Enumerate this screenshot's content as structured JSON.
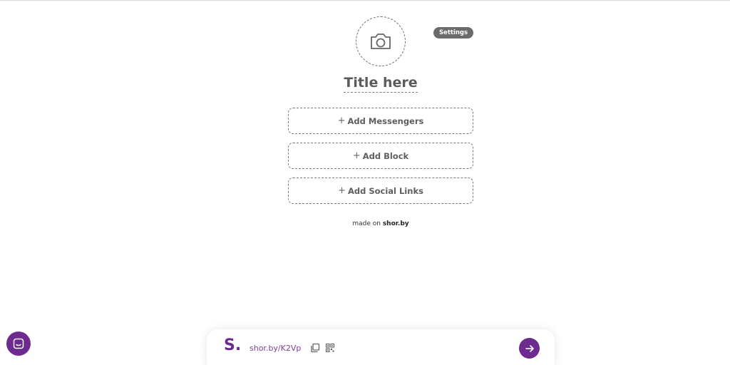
{
  "header": {
    "title": "Title here",
    "settings_label": "Settings"
  },
  "blocks": [
    {
      "label": "Add Messengers"
    },
    {
      "label": "Add Block"
    },
    {
      "label": "Add Social Links"
    }
  ],
  "footer": {
    "made_on_prefix": "made on",
    "brand": "shor.by"
  },
  "bottom_bar": {
    "logo": "S.",
    "short_link": "shor.by/K2Vp"
  },
  "icons": {
    "avatar": "camera-icon",
    "copy": "copy-icon",
    "qr": "qr-code-icon",
    "go": "arrow-right-icon",
    "chat": "chat-icon"
  },
  "colors": {
    "accent": "#6d2a8f",
    "link": "#7b3f98",
    "settings_bg": "#6b6b6b"
  }
}
